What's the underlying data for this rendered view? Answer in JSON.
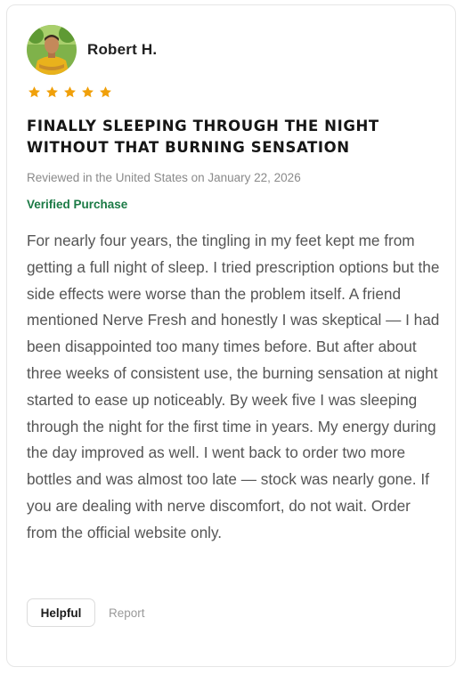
{
  "review": {
    "reviewer_name": "Robert H.",
    "avatar_icon": "person-avatar",
    "rating": 5,
    "rating_max": 5,
    "star_color": "#f0a00a",
    "headline": "Finally sleeping through the night without that burning sensation",
    "meta": "Reviewed in the United States on January 22, 2026",
    "verified_label": "Verified Purchase",
    "verified_color": "#1b7a45",
    "body": "For nearly four years, the tingling in my feet kept me from getting a full night of sleep. I tried prescription options but the side effects were worse than the problem itself. A friend mentioned Nerve Fresh and honestly I was skeptical — I had been disappointed too many times before. But after about three weeks of consistent use, the burning sensation at night started to ease up noticeably. By week five I was sleeping through the night for the first time in years. My energy during the day improved as well. I went back to order two more bottles and was almost too late — stock was nearly gone. If you are dealing with nerve discomfort, do not wait. Order from the official website only."
  },
  "actions": {
    "helpful_label": "Helpful",
    "report_label": "Report"
  }
}
